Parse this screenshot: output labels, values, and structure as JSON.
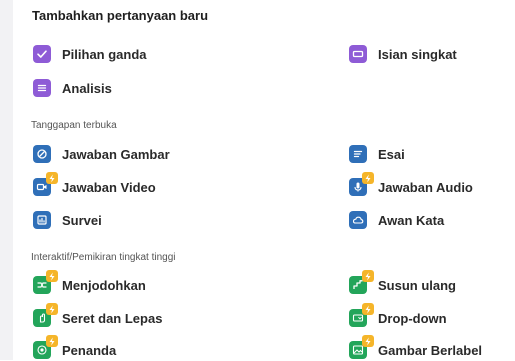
{
  "panel": {
    "title": "Tambahkan pertanyaan baru"
  },
  "groups": [
    {
      "label": "",
      "items": [
        {
          "label": "Pilihan ganda",
          "icon": "check-icon",
          "color": "#8e5bd6"
        },
        {
          "label": "Isian singkat",
          "icon": "textbox-icon",
          "color": "#8e5bd6"
        },
        {
          "label": "Analisis",
          "icon": "lines-icon",
          "color": "#8e5bd6"
        }
      ]
    },
    {
      "label": "Tanggapan terbuka",
      "items": [
        {
          "label": "Jawaban Gambar",
          "icon": "draw-icon",
          "color": "#2f6fb8"
        },
        {
          "label": "Esai",
          "icon": "text-lines-icon",
          "color": "#2f6fb8"
        },
        {
          "label": "Jawaban Video",
          "icon": "video-icon",
          "color": "#2f6fb8",
          "badge": "lightning-icon"
        },
        {
          "label": "Jawaban Audio",
          "icon": "microphone-icon",
          "color": "#2f6fb8",
          "badge": "lightning-icon"
        },
        {
          "label": "Survei",
          "icon": "poll-icon",
          "color": "#2f6fb8"
        },
        {
          "label": "Awan Kata",
          "icon": "cloud-icon",
          "color": "#2f6fb8"
        }
      ]
    },
    {
      "label": "Interaktif/Pemikiran tingkat tinggi",
      "items": [
        {
          "label": "Menjodohkan",
          "icon": "match-icon",
          "color": "#23a55a",
          "badge": "lightning-icon"
        },
        {
          "label": "Susun ulang",
          "icon": "reorder-icon",
          "color": "#23a55a",
          "badge": "lightning-icon"
        },
        {
          "label": "Seret dan Lepas",
          "icon": "drag-icon",
          "color": "#23a55a",
          "badge": "lightning-icon"
        },
        {
          "label": "Drop-down",
          "icon": "dropdown-icon",
          "color": "#23a55a",
          "badge": "lightning-icon"
        },
        {
          "label": "Penanda",
          "icon": "hotspot-icon",
          "color": "#23a55a",
          "badge": "lightning-icon"
        },
        {
          "label": "Gambar Berlabel",
          "icon": "labeled-image-icon",
          "color": "#23a55a",
          "badge": "lightning-icon"
        }
      ]
    }
  ]
}
